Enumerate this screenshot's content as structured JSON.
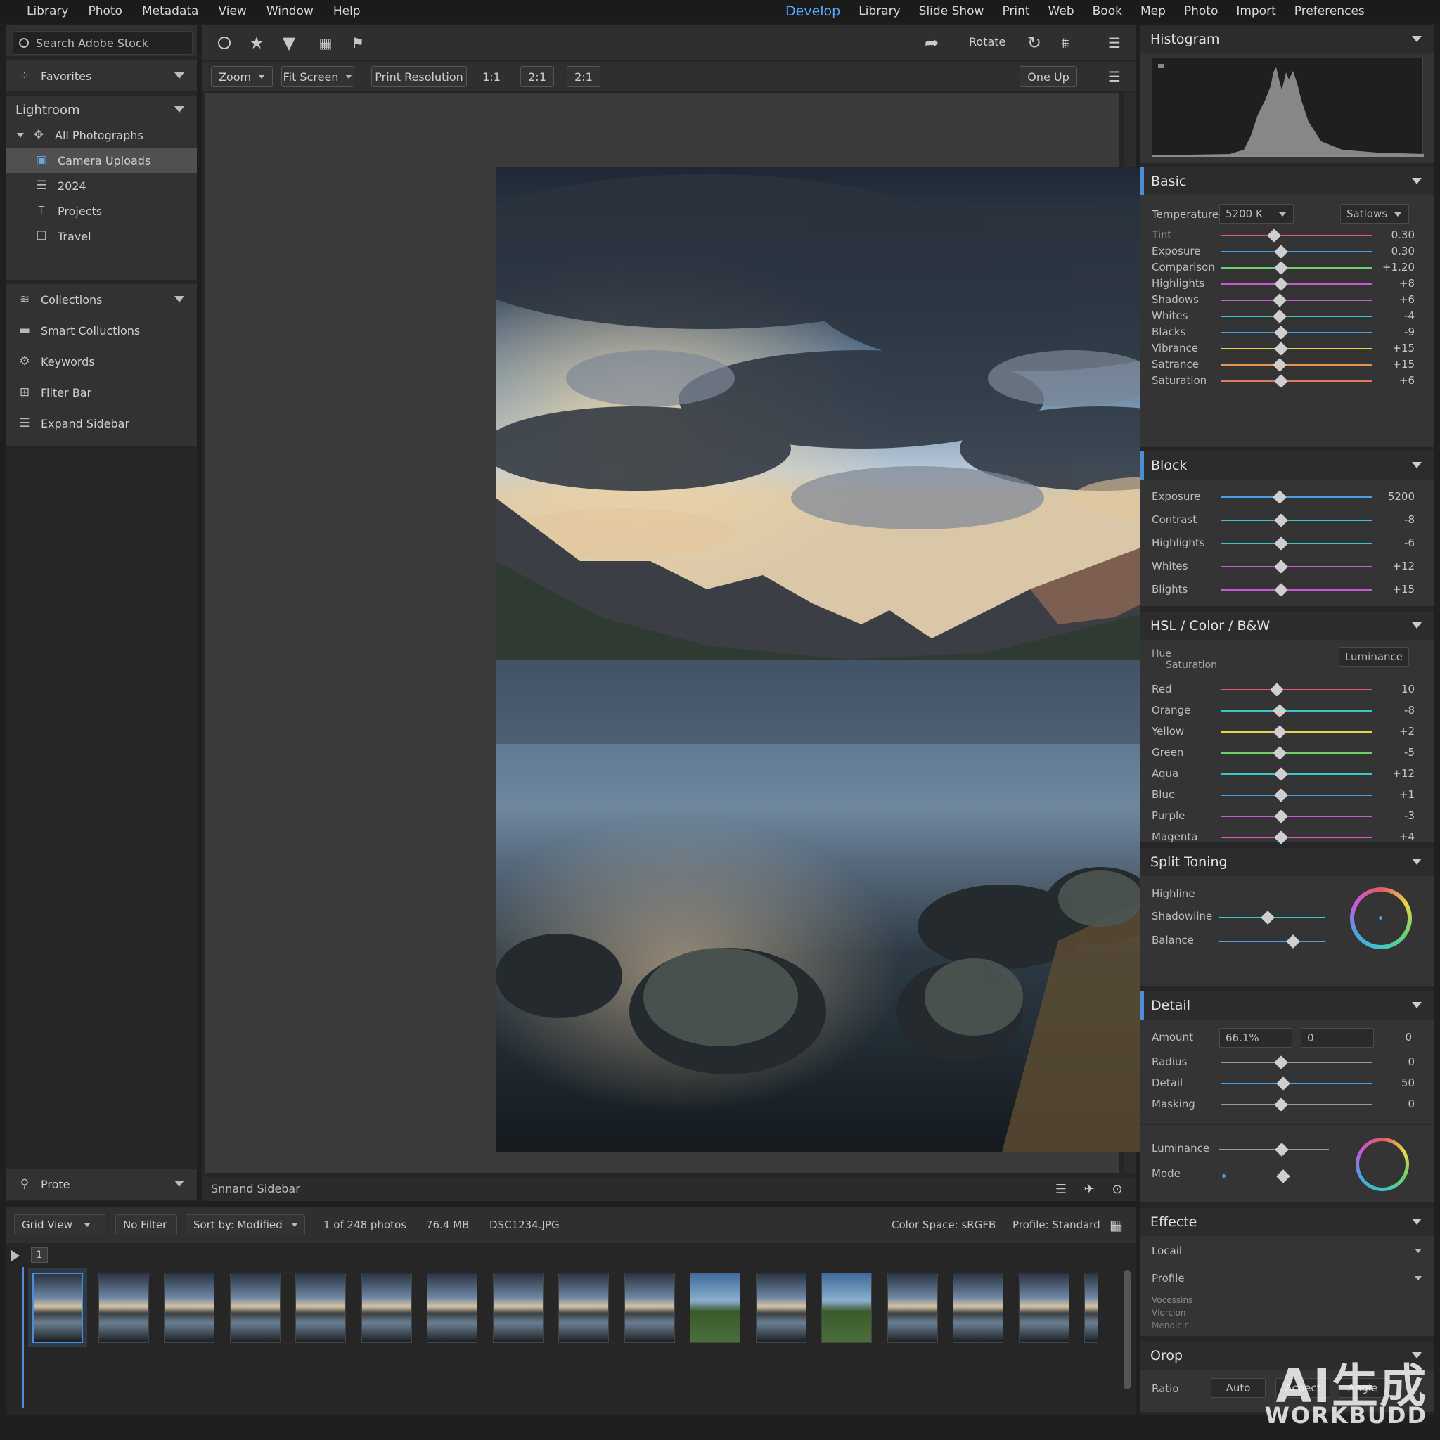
{
  "menubar": {
    "left": [
      "Library",
      "Photo",
      "Metadata",
      "View",
      "Window",
      "Help"
    ],
    "right": [
      "Develop",
      "Library",
      "Slide Show",
      "Print",
      "Web",
      "Book",
      "Mep",
      "Photo",
      "Import",
      "Preferences"
    ]
  },
  "left": {
    "search_placeholder": "Search Adobe Stock",
    "favorites": "Favorites",
    "lightroom": "Lightroom",
    "lightroom_items": [
      "All Photographs",
      "Camera Uploads",
      "2024",
      "Projects",
      "Travel"
    ],
    "collections": "Collections",
    "collection_items": [
      "Smart Coliuctions",
      "Keywords",
      "Filter Bar",
      "Expand Sidebar"
    ],
    "bottom_item": "Prote"
  },
  "toolbar": {
    "rotate": "Rotate",
    "zoom": "Zoom",
    "fit_screen": "Fit Screen",
    "print_resolution": "Print Resolution",
    "z11": "1:1",
    "z21a": "2:1",
    "z21b": "2:1",
    "one_up": "One Up"
  },
  "viewer": {
    "status": "Snnand Sidebar"
  },
  "bottom": {
    "grid_view": "Grid View",
    "no_filter": "No Filter",
    "sort": "Sort by: Modified",
    "count": "1 of 248 photos",
    "size": "76.4 MB",
    "file": "DSC1234.JPG",
    "color_space": "Color Space: sRGFB",
    "profile": "Profile: Standard",
    "page": "1"
  },
  "right": {
    "histogram": "Histogram",
    "basic": {
      "title": "Basic",
      "temperature_label": "Temperature",
      "temperature_value": "5200 K",
      "preset": "Satlows",
      "sliders": [
        {
          "label": "Tint",
          "value": "0.30",
          "pos": 0.35,
          "color": "#e05a6a"
        },
        {
          "label": "Exposure",
          "value": "0.30",
          "pos": 0.4,
          "color": "#4aa0e6"
        },
        {
          "label": "Comparison",
          "value": "+1.20",
          "pos": 0.4,
          "color": "#6bd26b"
        },
        {
          "label": "Highlights",
          "value": "+8",
          "pos": 0.4,
          "color": "#c95ad6"
        },
        {
          "label": "Shadows",
          "value": "+6",
          "pos": 0.39,
          "color": "#c95ad6"
        },
        {
          "label": "Whites",
          "value": "-4",
          "pos": 0.39,
          "color": "#3ec6c6"
        },
        {
          "label": "Blacks",
          "value": "-9",
          "pos": 0.4,
          "color": "#4aa0e6"
        },
        {
          "label": "Vibrance",
          "value": "+15",
          "pos": 0.4,
          "color": "#e6d84a"
        },
        {
          "label": "Satrance",
          "value": "+15",
          "pos": 0.39,
          "color": "#e8944a"
        },
        {
          "label": "Saturation",
          "value": "+6",
          "pos": 0.4,
          "color": "#e07a5a"
        }
      ]
    },
    "block": {
      "title": "Block",
      "sliders": [
        {
          "label": "Exposure",
          "value": "5200",
          "pos": 0.39,
          "color": "#4aa0e6"
        },
        {
          "label": "Contrast",
          "value": "-8",
          "pos": 0.4,
          "color": "#3ec6c6"
        },
        {
          "label": "Highlights",
          "value": "-6",
          "pos": 0.4,
          "color": "#3ec6c6"
        },
        {
          "label": "Whites",
          "value": "+12",
          "pos": 0.4,
          "color": "#c95ad6"
        },
        {
          "label": "Blights",
          "value": "+15",
          "pos": 0.4,
          "color": "#c95ad6"
        }
      ]
    },
    "hsl": {
      "title": "HSL / Color / B&W",
      "hue": "Hue",
      "saturation": "Saturation",
      "luminance": "Luminance",
      "sliders": [
        {
          "label": "Red",
          "value": "10",
          "pos": 0.37,
          "color": "#e05a6a"
        },
        {
          "label": "Orange",
          "value": "-8",
          "pos": 0.39,
          "color": "#3ec6c6"
        },
        {
          "label": "Yellow",
          "value": "+2",
          "pos": 0.39,
          "color": "#e6d84a"
        },
        {
          "label": "Green",
          "value": "-5",
          "pos": 0.39,
          "color": "#6bd26b"
        },
        {
          "label": "Aqua",
          "value": "+12",
          "pos": 0.4,
          "color": "#3ec6c6"
        },
        {
          "label": "Blue",
          "value": "+1",
          "pos": 0.4,
          "color": "#4aa0e6"
        },
        {
          "label": "Purple",
          "value": "-3",
          "pos": 0.4,
          "color": "#c95ad6"
        },
        {
          "label": "Magenta",
          "value": "+4",
          "pos": 0.4,
          "color": "#d65ac0"
        }
      ]
    },
    "split": {
      "title": "Split Toning",
      "highline": "Highline",
      "shadowline": "Shadowiine",
      "balance": "Balance"
    },
    "detail": {
      "title": "Detail",
      "amount": "Amount",
      "amount_value": "66.1%",
      "amount_field2": "0",
      "amount_right": "0",
      "sliders": [
        {
          "label": "Radius",
          "value": "0",
          "pos": 0.4,
          "color": "#9a9a9a"
        },
        {
          "label": "Detail",
          "value": "50",
          "pos": 0.41,
          "color": "#4aa0e6"
        },
        {
          "label": "Masking",
          "value": "0",
          "pos": 0.4,
          "color": "#9a9a9a"
        }
      ],
      "luminance": "Luminance",
      "mode": "Mode"
    },
    "effects": {
      "title": "Effecte",
      "local": "Locail",
      "profile": "Profile",
      "sub": [
        "Vocessins",
        "Vlorcion",
        "Mendicir"
      ]
    },
    "crop": {
      "title": "Orop",
      "ratio": "Ratio",
      "auto": "Auto",
      "aspect": "Acpect",
      "angle": "Angle"
    }
  },
  "watermark": {
    "line1": "AI生成",
    "line2": "WORKBUDD"
  }
}
